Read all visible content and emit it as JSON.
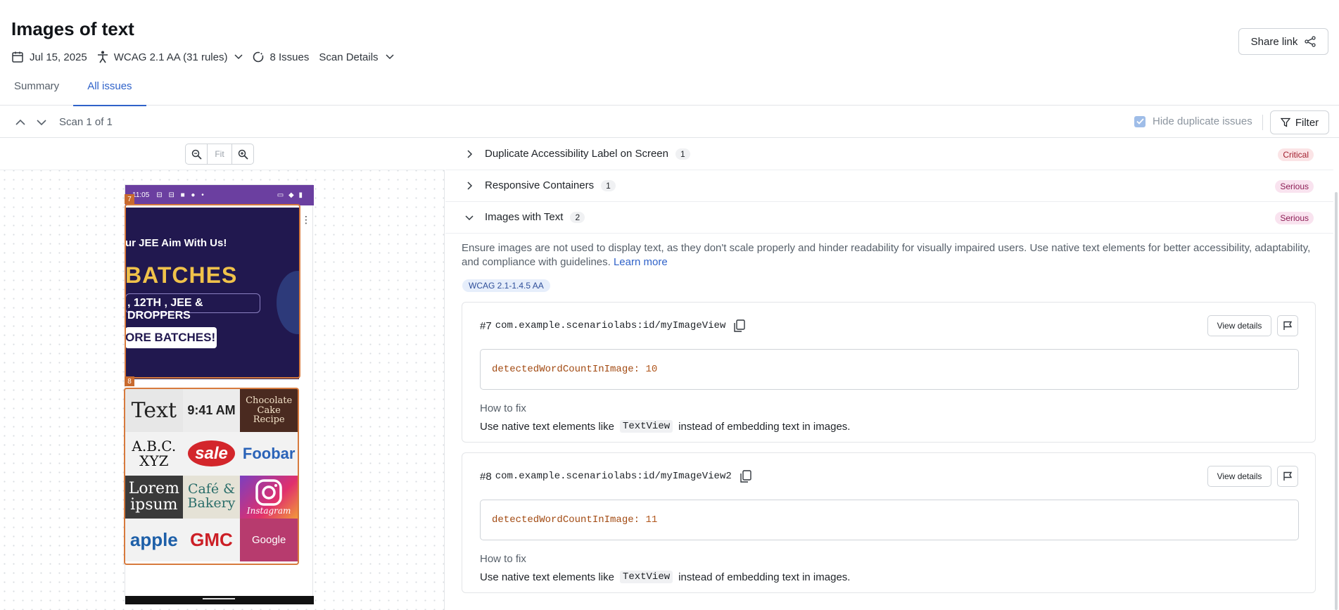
{
  "page": {
    "title": "Images of text",
    "date": "Jul 15, 2025",
    "standard": "WCAG 2.1 AA (31 rules)",
    "issues": "8 Issues",
    "scan_details": "Scan Details",
    "share_label": "Share link"
  },
  "tabs": [
    {
      "label": "Summary",
      "active": false
    },
    {
      "label": "All issues",
      "active": true
    }
  ],
  "toolbar": {
    "scan_label": "Scan 1 of 1",
    "hide_duplicates_label": "Hide duplicate issues",
    "hide_duplicates_checked": true,
    "filter_label": "Filter"
  },
  "viewer": {
    "zoom_fit": "Fit",
    "status_time": "11:05",
    "banner_line1": "ur JEE Aim With Us!",
    "banner_line2": "BATCHES",
    "banner_line3": ", 12TH , JEE & DROPPERS",
    "banner_line4": "ORE BATCHES!",
    "markers": [
      "7",
      "8"
    ],
    "grid_texts": [
      "Text",
      "9:41 AM",
      "Chocolate Cake Recipe",
      "A.B.C. XYZ",
      "sale",
      "Foobar",
      "Lorem ipsum",
      "Café & Bakery",
      "Instagram",
      "apple",
      "GMC",
      "Google"
    ]
  },
  "issues": [
    {
      "name": "Duplicate Accessibility Label on Screen",
      "count": "1",
      "severity": "Critical",
      "expanded": false
    },
    {
      "name": "Responsive Containers",
      "count": "1",
      "severity": "Serious",
      "expanded": false
    },
    {
      "name": "Images with Text",
      "count": "2",
      "severity": "Serious",
      "expanded": true
    }
  ],
  "detail": {
    "description": "Ensure images are not used to display text, as they don't scale properly and hinder readability for visually impaired users. Use native text elements for better accessibility, adaptability, and compliance with guidelines.",
    "learn_more": "Learn more",
    "wcag_badge": "WCAG 2.1-1.4.5 AA",
    "view_details_label": "View details",
    "how_to_fix_label": "How to fix",
    "fix_prefix": "Use native text elements like",
    "fix_code": "TextView",
    "fix_suffix": "instead of embedding text in images.",
    "cards": [
      {
        "number": "#7",
        "path": "com.example.scenariolabs:id/myImageView",
        "code_key": "detectedWordCountInImage:",
        "code_value": "10"
      },
      {
        "number": "#8",
        "path": "com.example.scenariolabs:id/myImageView2",
        "code_key": "detectedWordCountInImage:",
        "code_value": "11"
      }
    ]
  },
  "colors": {
    "accent": "#2f62c9",
    "critical_bg": "#fbe4e6",
    "serious_bg": "#f9e3ef",
    "highlight": "#d77a3d",
    "statusbar": "#6b3fa0"
  }
}
